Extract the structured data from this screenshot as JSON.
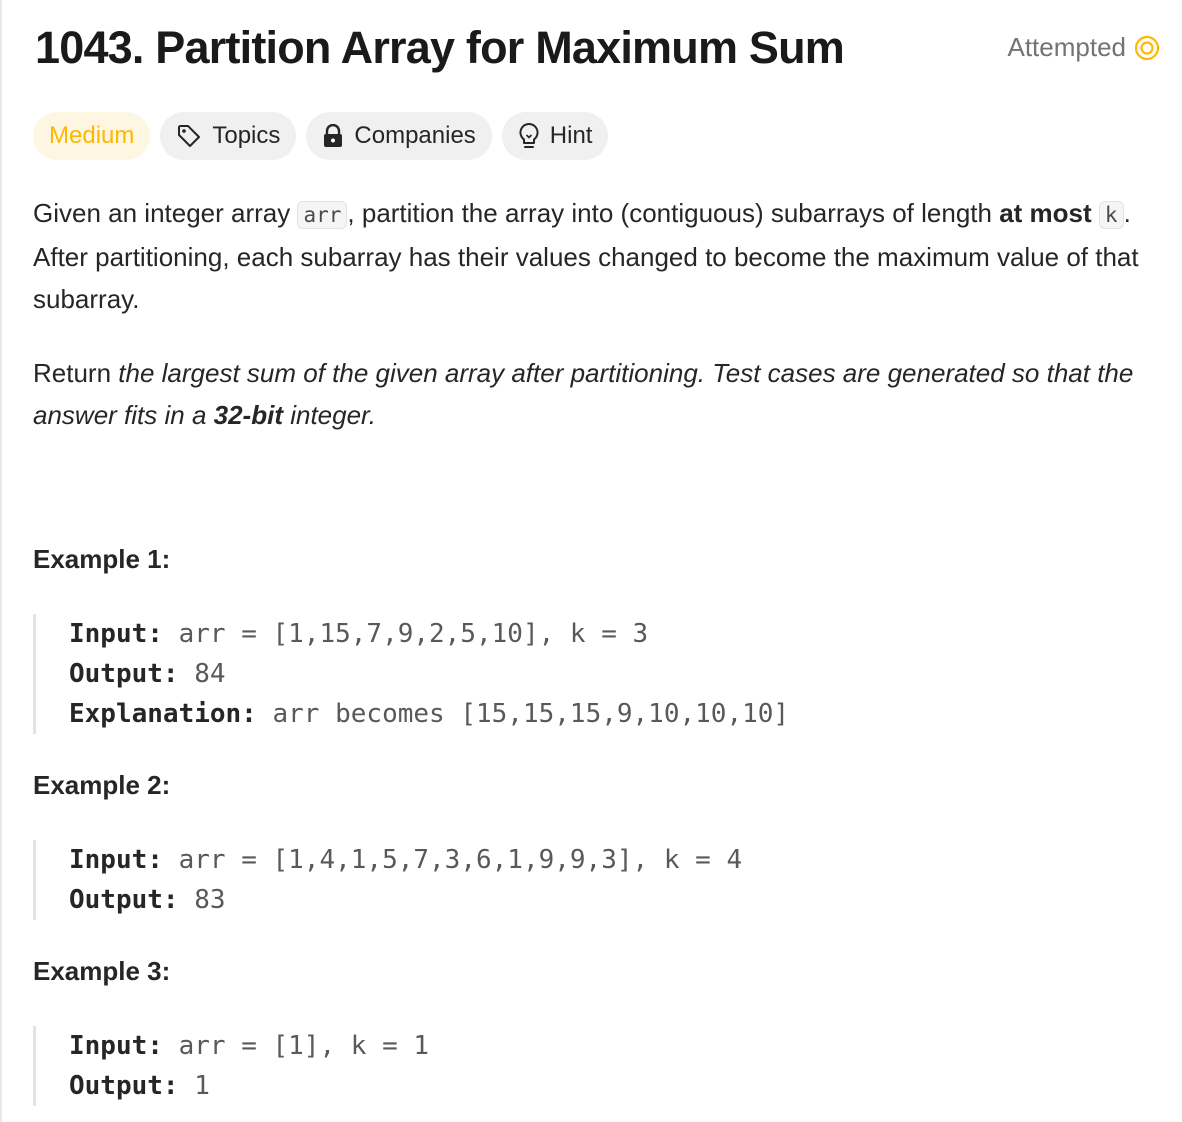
{
  "problem": {
    "title": "1043. Partition Array for Maximum Sum",
    "status": "Attempted",
    "status_color": "#ffb800"
  },
  "tags": {
    "difficulty": "Medium",
    "topics": "Topics",
    "companies": "Companies",
    "hint": "Hint"
  },
  "description": {
    "p1_a": "Given an integer array ",
    "p1_code_arr": "arr",
    "p1_b": ", partition the array into (contiguous) subarrays of length ",
    "p1_bold": "at most",
    "p1_c": " ",
    "p1_code_k": "k",
    "p1_d": ". After partitioning, each subarray has their values changed to become the maximum value of that subarray.",
    "p2_a": "Return ",
    "p2_em1": "the largest sum of the given array after partitioning. Test cases are generated so that the answer fits in a ",
    "p2_bold": "32-bit",
    "p2_em2": " integer."
  },
  "examples": [
    {
      "title": "Example 1:",
      "input_label": "Input:",
      "input_value": " arr = [1,15,7,9,2,5,10], k = 3",
      "output_label": "Output:",
      "output_value": " 84",
      "explanation_label": "Explanation:",
      "explanation_value": " arr becomes [15,15,15,9,10,10,10]"
    },
    {
      "title": "Example 2:",
      "input_label": "Input:",
      "input_value": " arr = [1,4,1,5,7,3,6,1,9,9,3], k = 4",
      "output_label": "Output:",
      "output_value": " 83"
    },
    {
      "title": "Example 3:",
      "input_label": "Input:",
      "input_value": " arr = [1], k = 1",
      "output_label": "Output:",
      "output_value": " 1"
    }
  ]
}
